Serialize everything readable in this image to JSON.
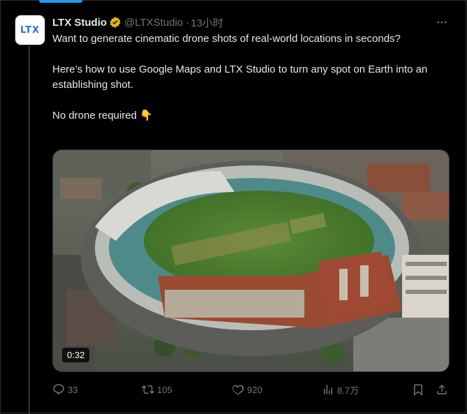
{
  "tweet": {
    "avatar_text": "LTX",
    "author_name": "LTX Studio",
    "author_handle": "@LTXStudio",
    "separator": "·",
    "time": "13小时",
    "lines": [
      "Want to generate cinematic drone shots of real-world locations in seconds?",
      "Here’s how to use Google Maps and LTX Studio to turn any spot on Earth into an establishing shot.",
      "No drone required 👇"
    ],
    "video_duration": "0:32"
  },
  "actions": {
    "replies": "33",
    "retweets": "105",
    "likes": "920",
    "views": "8.7万"
  },
  "colors": {
    "accent": "#1d9bf0",
    "verified_gold": "#e2b719",
    "muted": "#71767b"
  },
  "icons": [
    "verified-badge-icon",
    "more-icon",
    "reply-icon",
    "retweet-icon",
    "like-icon",
    "views-icon",
    "bookmark-icon",
    "share-icon"
  ]
}
